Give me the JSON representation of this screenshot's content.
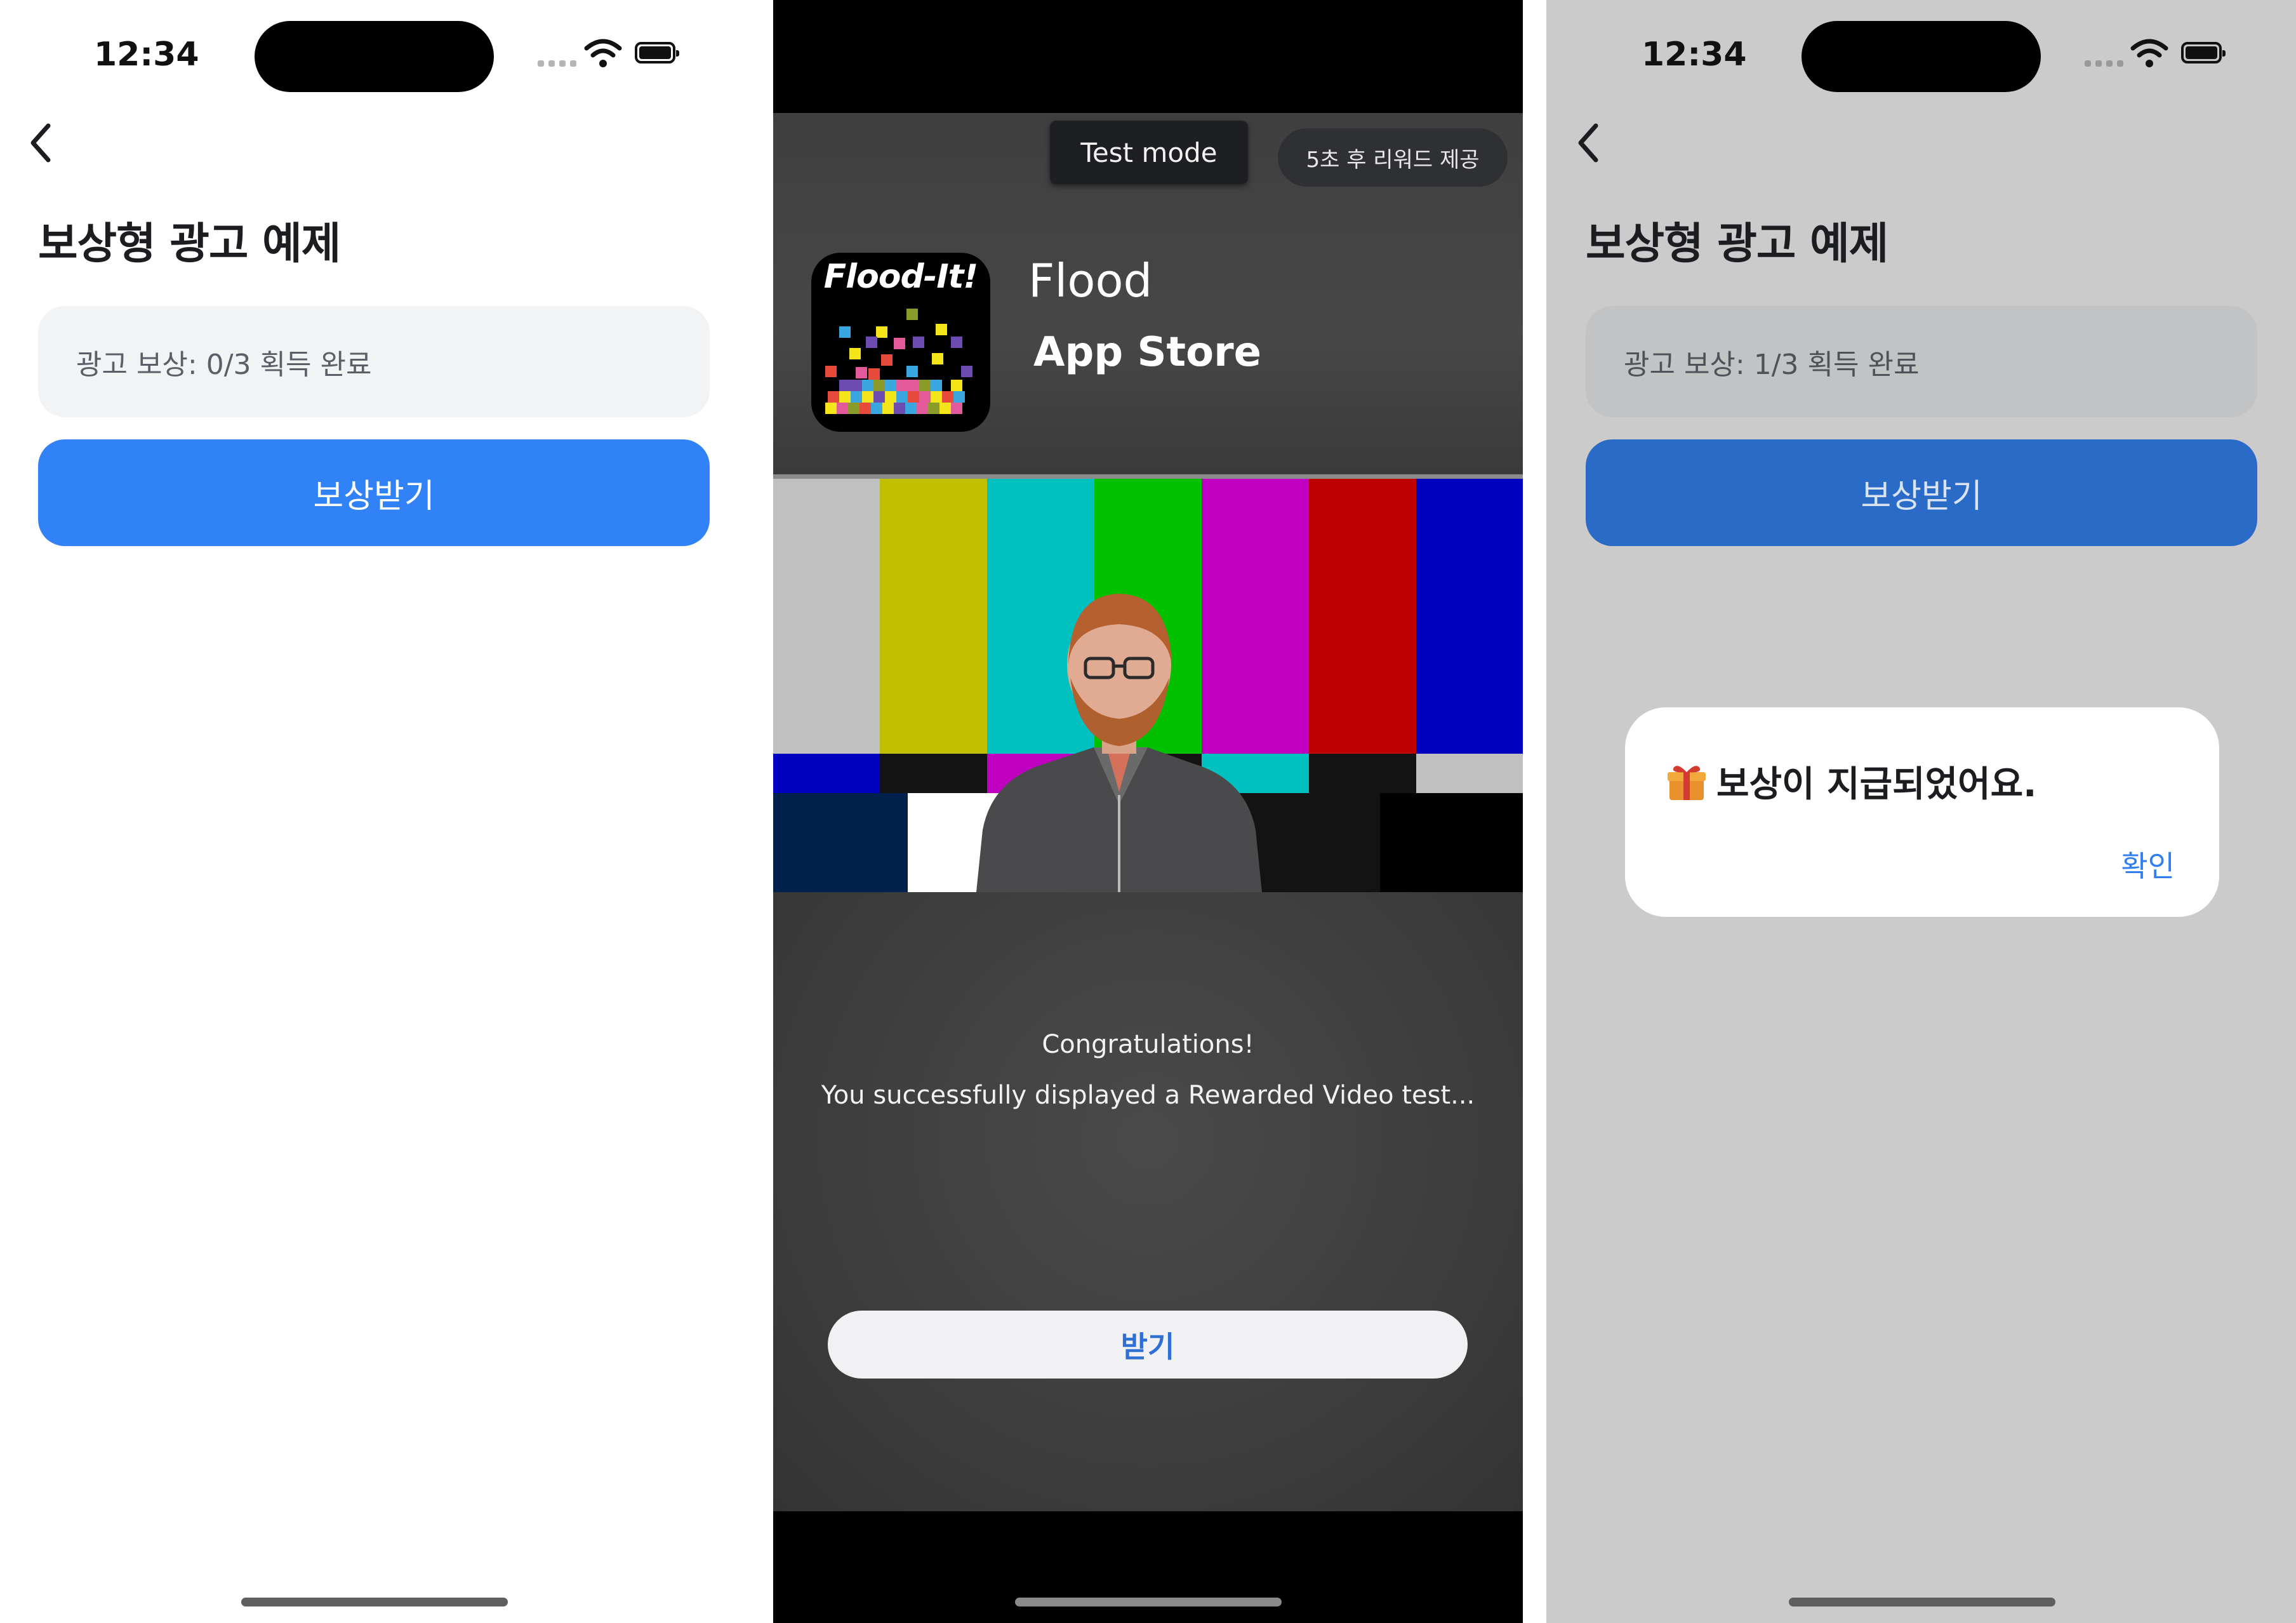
{
  "status_bar": {
    "time": "12:34"
  },
  "left_screen": {
    "title": "보상형 광고 예제",
    "reward_status": "광고 보상: 0/3 획득 완료",
    "claim_button": "보상받기"
  },
  "ad_screen": {
    "test_mode": "Test mode",
    "reward_countdown": "5초 후 리워드 제공",
    "app_icon_text": "Flood-It!",
    "app_name": "Flood",
    "store_name": "App Store",
    "message_title": "Congratulations!",
    "message_body": "You successfully displayed a Rewarded Video test...",
    "get_button": "받기"
  },
  "right_screen": {
    "title": "보상형 광고 예제",
    "reward_status": "광고 보상: 1/3 획득 완료",
    "claim_button": "보상받기",
    "dialog_message": "보상이 지급되었어요.",
    "dialog_confirm": "확인"
  },
  "colors": {
    "primary_blue": "#3182f6",
    "dimmed_blue": "#2a6bc8",
    "dialog_link": "#2f7ff0",
    "ad_button_text": "#2f6fd6"
  },
  "icons": [
    "back-chevron-icon",
    "wifi-icon",
    "battery-icon",
    "gift-icon",
    "cellular-signal-icon"
  ]
}
